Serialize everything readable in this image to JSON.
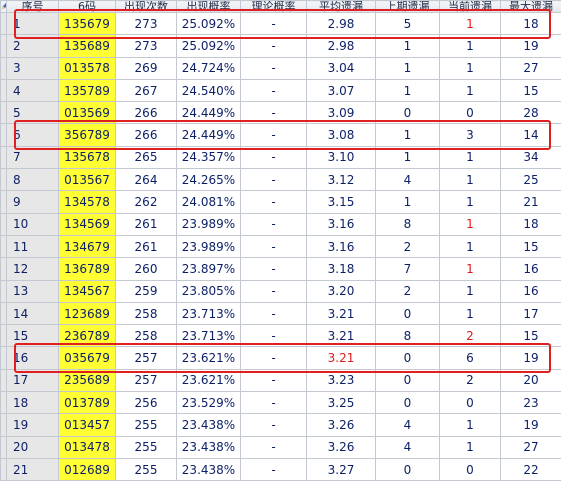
{
  "columns": [
    "",
    "序号",
    "6码",
    "出现次数",
    "出现概率",
    "理论概率",
    "平均遗漏",
    "上期遗漏",
    "当前遗漏",
    "最大遗漏"
  ],
  "rows": [
    {
      "idx": "1",
      "code": "135679",
      "count": "273",
      "prob": "25.092%",
      "theory": "-",
      "avg": "2.98",
      "last": "5",
      "cur": "1",
      "max": "18",
      "red": [
        "cur"
      ]
    },
    {
      "idx": "2",
      "code": "135689",
      "count": "273",
      "prob": "25.092%",
      "theory": "-",
      "avg": "2.98",
      "last": "1",
      "cur": "1",
      "max": "19",
      "red": []
    },
    {
      "idx": "3",
      "code": "013578",
      "count": "269",
      "prob": "24.724%",
      "theory": "-",
      "avg": "3.04",
      "last": "1",
      "cur": "1",
      "max": "27",
      "red": []
    },
    {
      "idx": "4",
      "code": "135789",
      "count": "267",
      "prob": "24.540%",
      "theory": "-",
      "avg": "3.07",
      "last": "1",
      "cur": "1",
      "max": "15",
      "red": []
    },
    {
      "idx": "5",
      "code": "013569",
      "count": "266",
      "prob": "24.449%",
      "theory": "-",
      "avg": "3.09",
      "last": "0",
      "cur": "0",
      "max": "28",
      "red": []
    },
    {
      "idx": "6",
      "code": "356789",
      "count": "266",
      "prob": "24.449%",
      "theory": "-",
      "avg": "3.08",
      "last": "1",
      "cur": "3",
      "max": "14",
      "red": []
    },
    {
      "idx": "7",
      "code": "135678",
      "count": "265",
      "prob": "24.357%",
      "theory": "-",
      "avg": "3.10",
      "last": "1",
      "cur": "1",
      "max": "34",
      "red": []
    },
    {
      "idx": "8",
      "code": "013567",
      "count": "264",
      "prob": "24.265%",
      "theory": "-",
      "avg": "3.12",
      "last": "4",
      "cur": "1",
      "max": "25",
      "red": []
    },
    {
      "idx": "9",
      "code": "134578",
      "count": "262",
      "prob": "24.081%",
      "theory": "-",
      "avg": "3.15",
      "last": "1",
      "cur": "1",
      "max": "21",
      "red": []
    },
    {
      "idx": "10",
      "code": "134569",
      "count": "261",
      "prob": "23.989%",
      "theory": "-",
      "avg": "3.16",
      "last": "8",
      "cur": "1",
      "max": "18",
      "red": [
        "cur"
      ]
    },
    {
      "idx": "11",
      "code": "134679",
      "count": "261",
      "prob": "23.989%",
      "theory": "-",
      "avg": "3.16",
      "last": "2",
      "cur": "1",
      "max": "15",
      "red": []
    },
    {
      "idx": "12",
      "code": "136789",
      "count": "260",
      "prob": "23.897%",
      "theory": "-",
      "avg": "3.18",
      "last": "7",
      "cur": "1",
      "max": "16",
      "red": [
        "cur"
      ]
    },
    {
      "idx": "13",
      "code": "134567",
      "count": "259",
      "prob": "23.805%",
      "theory": "-",
      "avg": "3.20",
      "last": "2",
      "cur": "1",
      "max": "16",
      "red": []
    },
    {
      "idx": "14",
      "code": "123689",
      "count": "258",
      "prob": "23.713%",
      "theory": "-",
      "avg": "3.21",
      "last": "0",
      "cur": "1",
      "max": "17",
      "red": []
    },
    {
      "idx": "15",
      "code": "236789",
      "count": "258",
      "prob": "23.713%",
      "theory": "-",
      "avg": "3.21",
      "last": "8",
      "cur": "2",
      "max": "15",
      "red": [
        "cur"
      ]
    },
    {
      "idx": "16",
      "code": "035679",
      "count": "257",
      "prob": "23.621%",
      "theory": "-",
      "avg": "3.21",
      "last": "0",
      "cur": "6",
      "max": "19",
      "red": [
        "avg"
      ]
    },
    {
      "idx": "17",
      "code": "235689",
      "count": "257",
      "prob": "23.621%",
      "theory": "-",
      "avg": "3.23",
      "last": "0",
      "cur": "2",
      "max": "20",
      "red": []
    },
    {
      "idx": "18",
      "code": "013789",
      "count": "256",
      "prob": "23.529%",
      "theory": "-",
      "avg": "3.25",
      "last": "0",
      "cur": "0",
      "max": "23",
      "red": []
    },
    {
      "idx": "19",
      "code": "013457",
      "count": "255",
      "prob": "23.438%",
      "theory": "-",
      "avg": "3.26",
      "last": "4",
      "cur": "1",
      "max": "19",
      "red": []
    },
    {
      "idx": "20",
      "code": "013478",
      "count": "255",
      "prob": "23.438%",
      "theory": "-",
      "avg": "3.26",
      "last": "4",
      "cur": "1",
      "max": "27",
      "red": []
    },
    {
      "idx": "21",
      "code": "012689",
      "count": "255",
      "prob": "23.438%",
      "theory": "-",
      "avg": "3.27",
      "last": "0",
      "cur": "0",
      "max": "22",
      "red": []
    }
  ],
  "highlighted_rows": [
    "1",
    "6",
    "16"
  ],
  "colors": {
    "highlight_border": "#e02020",
    "code_bg": "#ffff33",
    "index_bg": "#e7e7e7",
    "red_text": "#e11b1b",
    "cell_text": "#0b1f66"
  },
  "icons": {
    "corner": "edit-pencil-icon"
  }
}
